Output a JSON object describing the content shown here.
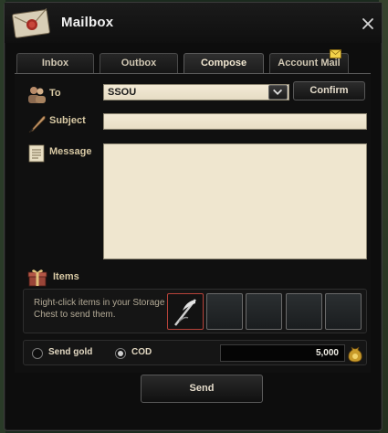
{
  "window": {
    "title": "Mailbox"
  },
  "tabs": [
    {
      "label": "Inbox"
    },
    {
      "label": "Outbox"
    },
    {
      "label": "Compose"
    },
    {
      "label": "Account Mail"
    }
  ],
  "compose": {
    "to_label": "To",
    "to_value": "SSOU",
    "confirm_label": "Confirm",
    "subject_label": "Subject",
    "subject_value": "",
    "message_label": "Message",
    "message_value": ""
  },
  "items": {
    "label": "Items",
    "hint": "Right-click items in your Storage Chest to send them."
  },
  "payment": {
    "send_gold_label": "Send gold",
    "cod_label": "COD",
    "selected": "COD",
    "amount": "5,000"
  },
  "send_label": "Send"
}
